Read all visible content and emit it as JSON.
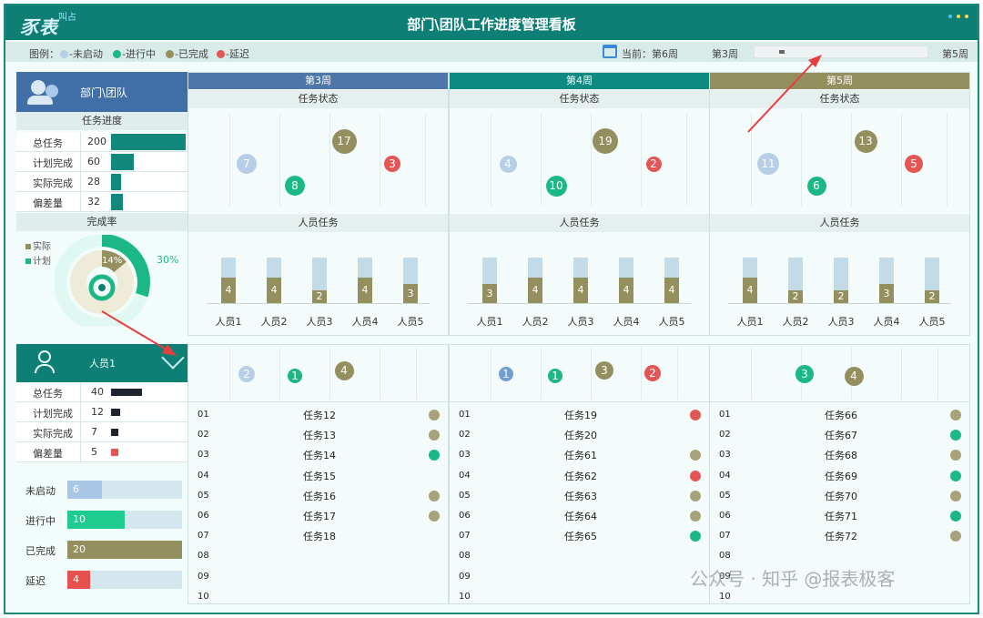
{
  "app": {
    "logo": "豕表",
    "logo_sub": "叫占",
    "title": "部门\\团队工作进度管理看板"
  },
  "legend": {
    "label": "图例：",
    "items": [
      {
        "label": "-未启动",
        "color": "#b7cfe6"
      },
      {
        "label": "-进行中",
        "color": "#1bb886"
      },
      {
        "label": "-已完成",
        "color": "#948f5f"
      },
      {
        "label": "-延迟",
        "color": "#e45555"
      }
    ],
    "current": "当前：第6周",
    "range_start": "第3周",
    "range_end": "第5周"
  },
  "dept": {
    "title": "部门\\团队",
    "progress_header": "任务进度",
    "kpis": [
      {
        "label": "总任务",
        "value": "200",
        "ratio": 1.0
      },
      {
        "label": "计划完成",
        "value": "60",
        "ratio": 0.3
      },
      {
        "label": "实际完成",
        "value": "28",
        "ratio": 0.14
      },
      {
        "label": "偏差量",
        "value": "32",
        "ratio": 0.16
      }
    ],
    "rate_header": "完成率",
    "rate_legend": [
      "实际",
      "计划"
    ],
    "actual_pct": "14%",
    "plan_pct": "30%",
    "actual_ratio": 0.14,
    "plan_ratio": 0.3
  },
  "weeks": [
    {
      "name": "第3周",
      "color": "#4f76a8",
      "status_label": "任务状态",
      "people_label": "人员任务",
      "status": [
        {
          "v": "7",
          "c": "#b7cfe6"
        },
        {
          "v": "8",
          "c": "#1bb886"
        },
        {
          "v": "17",
          "c": "#948f5f"
        },
        {
          "v": "3",
          "c": "#e45555"
        }
      ],
      "people": [
        {
          "n": "人员1",
          "v": "4",
          "r": 1.0
        },
        {
          "n": "人员2",
          "v": "4",
          "r": 1.0
        },
        {
          "n": "人员3",
          "v": "2",
          "r": 0.5
        },
        {
          "n": "人员4",
          "v": "4",
          "r": 1.0
        },
        {
          "n": "人员5",
          "v": "3",
          "r": 0.75
        }
      ]
    },
    {
      "name": "第4周",
      "color": "#0e8a80",
      "status_label": "任务状态",
      "people_label": "人员任务",
      "status": [
        {
          "v": "4",
          "c": "#b7cfe6"
        },
        {
          "v": "10",
          "c": "#1bb886"
        },
        {
          "v": "19",
          "c": "#948f5f"
        },
        {
          "v": "2",
          "c": "#e45555"
        }
      ],
      "people": [
        {
          "n": "人员1",
          "v": "3",
          "r": 0.75
        },
        {
          "n": "人员2",
          "v": "4",
          "r": 1.0
        },
        {
          "n": "人员3",
          "v": "4",
          "r": 1.0
        },
        {
          "n": "人员4",
          "v": "4",
          "r": 1.0
        },
        {
          "n": "人员5",
          "v": "4",
          "r": 1.0
        }
      ]
    },
    {
      "name": "第5周",
      "color": "#948f5f",
      "status_label": "任务状态",
      "people_label": "人员任务",
      "status": [
        {
          "v": "11",
          "c": "#b7cfe6"
        },
        {
          "v": "6",
          "c": "#1bb886"
        },
        {
          "v": "13",
          "c": "#948f5f"
        },
        {
          "v": "5",
          "c": "#e45555"
        }
      ],
      "people": [
        {
          "n": "人员1",
          "v": "4",
          "r": 1.0
        },
        {
          "n": "人员2",
          "v": "2",
          "r": 0.5
        },
        {
          "n": "人员3",
          "v": "2",
          "r": 0.5
        },
        {
          "n": "人员4",
          "v": "3",
          "r": 0.75
        },
        {
          "n": "人员5",
          "v": "2",
          "r": 0.5
        }
      ]
    }
  ],
  "person": {
    "name": "人员1",
    "kpis": [
      {
        "label": "总任务",
        "value": "40",
        "ratio": 1.0
      },
      {
        "label": "计划完成",
        "value": "12",
        "ratio": 0.3
      },
      {
        "label": "实际完成",
        "value": "7",
        "ratio": 0.18
      },
      {
        "label": "偏差量",
        "value": "5",
        "ratio": 0.13
      }
    ],
    "status_bars": [
      {
        "label": "未启动",
        "value": "6",
        "ratio": 0.3,
        "color": "#a9c6e4"
      },
      {
        "label": "进行中",
        "value": "10",
        "ratio": 0.5,
        "color": "#1fcc90"
      },
      {
        "label": "已完成",
        "value": "20",
        "ratio": 1.0,
        "color": "#948f5f"
      },
      {
        "label": "延迟",
        "value": "4",
        "ratio": 0.2,
        "color": "#e85050"
      }
    ],
    "weeks": [
      {
        "status": [
          {
            "v": "2",
            "c": "#b7cfe6"
          },
          {
            "v": "1",
            "c": "#1bb886"
          },
          {
            "v": "4",
            "c": "#948f5f"
          }
        ],
        "tasks": [
          {
            "no": "01",
            "name": "任务12",
            "c": "#a8a27a"
          },
          {
            "no": "02",
            "name": "任务13",
            "c": "#a8a27a"
          },
          {
            "no": "03",
            "name": "任务14",
            "c": "#1bb886"
          },
          {
            "no": "04",
            "name": "任务15",
            "c": ""
          },
          {
            "no": "05",
            "name": "任务16",
            "c": "#a8a27a"
          },
          {
            "no": "06",
            "name": "任务17",
            "c": "#a8a27a"
          },
          {
            "no": "07",
            "name": "任务18",
            "c": ""
          },
          {
            "no": "08",
            "name": "",
            "c": ""
          },
          {
            "no": "09",
            "name": "",
            "c": ""
          },
          {
            "no": "10",
            "name": "",
            "c": ""
          }
        ]
      },
      {
        "status": [
          {
            "v": "1",
            "c": "#6f9fd0"
          },
          {
            "v": "1",
            "c": "#1bb886"
          },
          {
            "v": "3",
            "c": "#948f5f"
          },
          {
            "v": "2",
            "c": "#e45555"
          }
        ],
        "tasks": [
          {
            "no": "01",
            "name": "任务19",
            "c": "#e45555"
          },
          {
            "no": "02",
            "name": "任务20",
            "c": ""
          },
          {
            "no": "03",
            "name": "任务61",
            "c": "#a8a27a"
          },
          {
            "no": "04",
            "name": "任务62",
            "c": "#e45555"
          },
          {
            "no": "05",
            "name": "任务63",
            "c": "#a8a27a"
          },
          {
            "no": "06",
            "name": "任务64",
            "c": "#a8a27a"
          },
          {
            "no": "07",
            "name": "任务65",
            "c": "#1bb886"
          },
          {
            "no": "08",
            "name": "",
            "c": ""
          },
          {
            "no": "09",
            "name": "",
            "c": ""
          },
          {
            "no": "10",
            "name": "",
            "c": ""
          }
        ]
      },
      {
        "status": [
          {
            "v": "3",
            "c": "#1bb886"
          },
          {
            "v": "4",
            "c": "#948f5f"
          }
        ],
        "tasks": [
          {
            "no": "01",
            "name": "任务66",
            "c": "#a8a27a"
          },
          {
            "no": "02",
            "name": "任务67",
            "c": "#1bb886"
          },
          {
            "no": "03",
            "name": "任务68",
            "c": "#a8a27a"
          },
          {
            "no": "04",
            "name": "任务69",
            "c": "#1bb886"
          },
          {
            "no": "05",
            "name": "任务70",
            "c": "#a8a27a"
          },
          {
            "no": "06",
            "name": "任务71",
            "c": "#1bb886"
          },
          {
            "no": "07",
            "name": "任务72",
            "c": "#a8a27a"
          },
          {
            "no": "08",
            "name": "",
            "c": ""
          },
          {
            "no": "09",
            "name": "",
            "c": ""
          },
          {
            "no": "10",
            "name": "",
            "c": ""
          }
        ]
      }
    ]
  },
  "watermark": "公众号 · 知乎 @报表极客"
}
